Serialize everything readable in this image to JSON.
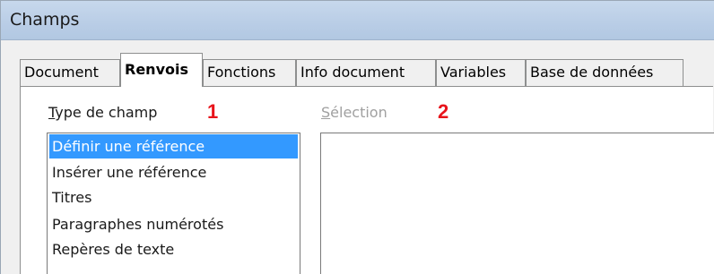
{
  "window": {
    "title": "Champs"
  },
  "tabs": [
    {
      "label": "Document",
      "active": false
    },
    {
      "label": "Renvois",
      "active": true
    },
    {
      "label": "Fonctions",
      "active": false
    },
    {
      "label": "Info document",
      "active": false
    },
    {
      "label": "Variables",
      "active": false
    },
    {
      "label": "Base de données",
      "active": false
    }
  ],
  "type_de_champ": {
    "label_accel": "T",
    "label_rest": "ype de champ",
    "marker": "1",
    "items": [
      {
        "label": "Définir une référence",
        "selected": true
      },
      {
        "label": "Insérer une référence",
        "selected": false
      },
      {
        "label": "Titres",
        "selected": false
      },
      {
        "label": "Paragraphes numérotés",
        "selected": false
      },
      {
        "label": "Repères de texte",
        "selected": false
      }
    ]
  },
  "selection": {
    "label_accel": "S",
    "label_rest": "élection",
    "marker": "2",
    "enabled": false
  },
  "colors": {
    "selected_bg": "#3399ff",
    "marker": "#e8141b",
    "disabled_text": "#a0a0a0"
  }
}
